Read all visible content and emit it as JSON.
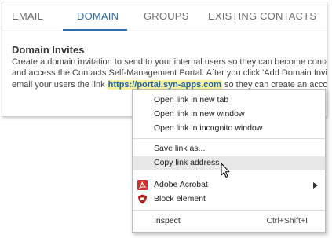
{
  "tabs": [
    {
      "label": "EMAIL"
    },
    {
      "label": "DOMAIN"
    },
    {
      "label": "GROUPS"
    },
    {
      "label": "EXISTING CONTACTS"
    }
  ],
  "active_tab": "DOMAIN",
  "section": {
    "title": "Domain Invites",
    "line1": "Create a domain invitation to send to your internal users so they can become contacts",
    "line2": "and access the Contacts Self-Management Portal. After you click 'Add Domain Invitation',",
    "line3_before": "email your users the link ",
    "link": "https://portal.syn-apps.com",
    "line3_after": " so they can create an account."
  },
  "context_menu": {
    "open_new_tab": "Open link in new tab",
    "open_new_window": "Open link in new window",
    "open_incognito": "Open link in incognito window",
    "save_link_as": "Save link as...",
    "copy_link_address": "Copy link address",
    "adobe_acrobat": "Adobe Acrobat",
    "block_element": "Block element",
    "inspect": "Inspect",
    "inspect_shortcut": "Ctrl+Shift+I"
  },
  "icons": {
    "adobe": "adobe-acrobat-icon",
    "ublock": "ublock-icon",
    "submenu": "chevron-right-icon",
    "cursor": "mouse-pointer-icon"
  },
  "colors": {
    "accent": "#2c6db1",
    "link": "#1e63b3",
    "highlight": "#f6f29a",
    "acrobat_red": "#d32f2f",
    "ublock_red": "#b3261e"
  }
}
